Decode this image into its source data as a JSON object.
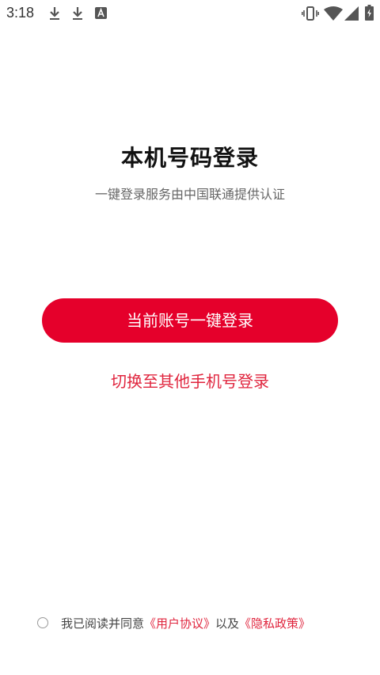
{
  "status_bar": {
    "time": "3:18",
    "left_icons": [
      "download-icon",
      "download-icon",
      "text-a-icon"
    ],
    "right_icons": [
      "vibrate-icon",
      "wifi-icon",
      "signal-icon",
      "battery-charging-icon"
    ]
  },
  "main": {
    "title": "本机号码登录",
    "subtitle": "一键登录服务由中国联通提供认证",
    "primary_button_label": "当前账号一键登录",
    "switch_link_label": "切换至其他手机号登录"
  },
  "agreement": {
    "checked": false,
    "prefix": "我已阅读并同意",
    "user_agreement": "《用户协议》",
    "connector": "以及",
    "privacy_policy": "《隐私政策》"
  },
  "colors": {
    "accent": "#e5002b",
    "link": "#e0253e",
    "title": "#111111",
    "subtitle": "#666666"
  }
}
